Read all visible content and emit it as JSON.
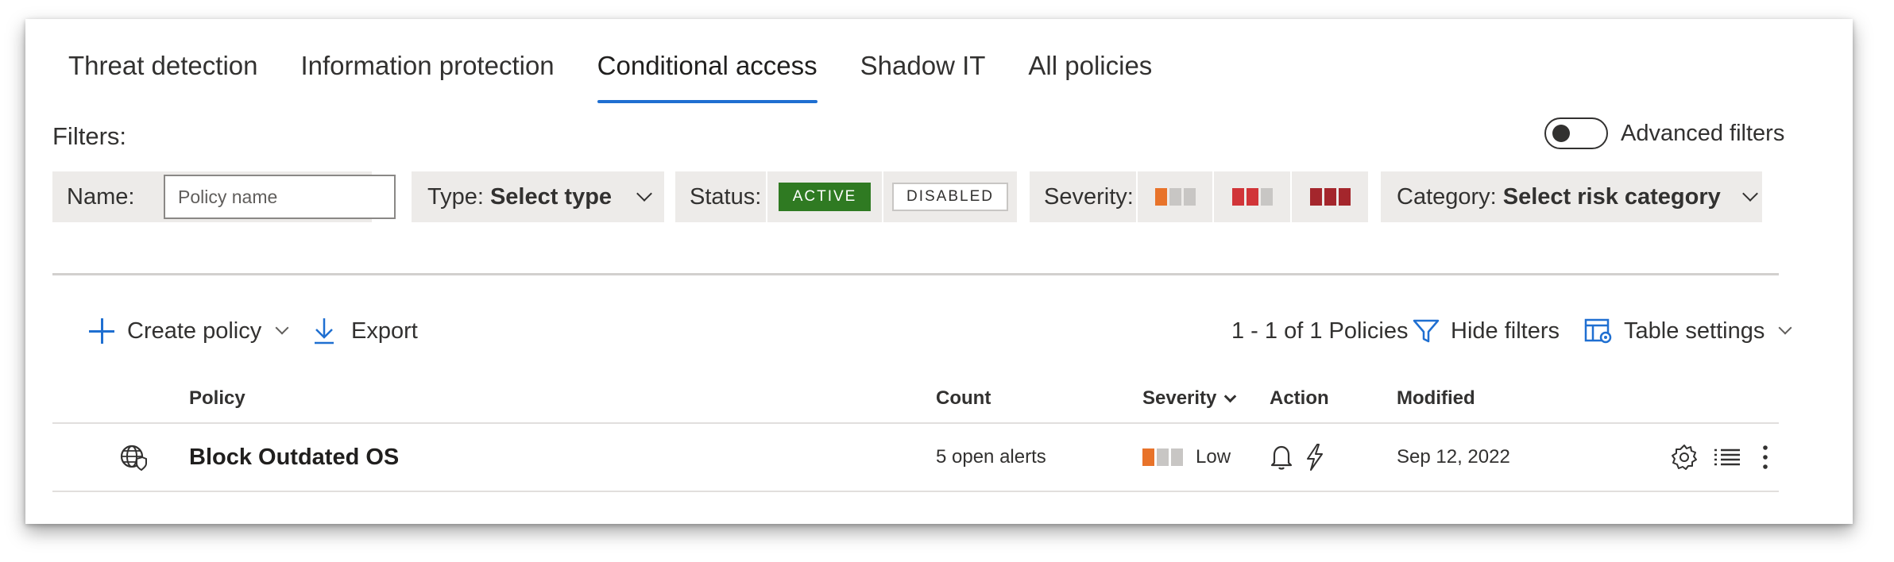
{
  "tabs": [
    {
      "label": "Threat detection",
      "active": false
    },
    {
      "label": "Information protection",
      "active": false
    },
    {
      "label": "Conditional access",
      "active": true
    },
    {
      "label": "Shadow IT",
      "active": false
    },
    {
      "label": "All policies",
      "active": false
    }
  ],
  "filters": {
    "label": "Filters:",
    "advanced_label": "Advanced filters",
    "advanced_enabled": false,
    "name": {
      "label": "Name:",
      "placeholder": "Policy name"
    },
    "type": {
      "label": "Type:",
      "value": "Select type"
    },
    "status": {
      "label": "Status:",
      "active": "ACTIVE",
      "disabled": "DISABLED"
    },
    "severity": {
      "label": "Severity:"
    },
    "category": {
      "label": "Category:",
      "value": "Select risk category"
    }
  },
  "toolbar": {
    "create_label": "Create policy",
    "export_label": "Export",
    "count_text": "1 - 1 of 1 Policies",
    "hide_filters_label": "Hide filters",
    "table_settings_label": "Table settings"
  },
  "table": {
    "columns": {
      "policy": "Policy",
      "count": "Count",
      "severity": "Severity",
      "action": "Action",
      "modified": "Modified"
    },
    "rows": [
      {
        "policy": "Block Outdated OS",
        "count": "5 open alerts",
        "severity": "Low",
        "modified": "Sep 12, 2022"
      }
    ]
  },
  "colors": {
    "accent": "#1f6fd1",
    "active_badge": "#2f7a22",
    "sev_low": "#e8732a",
    "sev_medium": "#d13438",
    "sev_high": "#a4262c",
    "sev_off": "#c8c6c4",
    "chip_bg": "#edebe9"
  }
}
